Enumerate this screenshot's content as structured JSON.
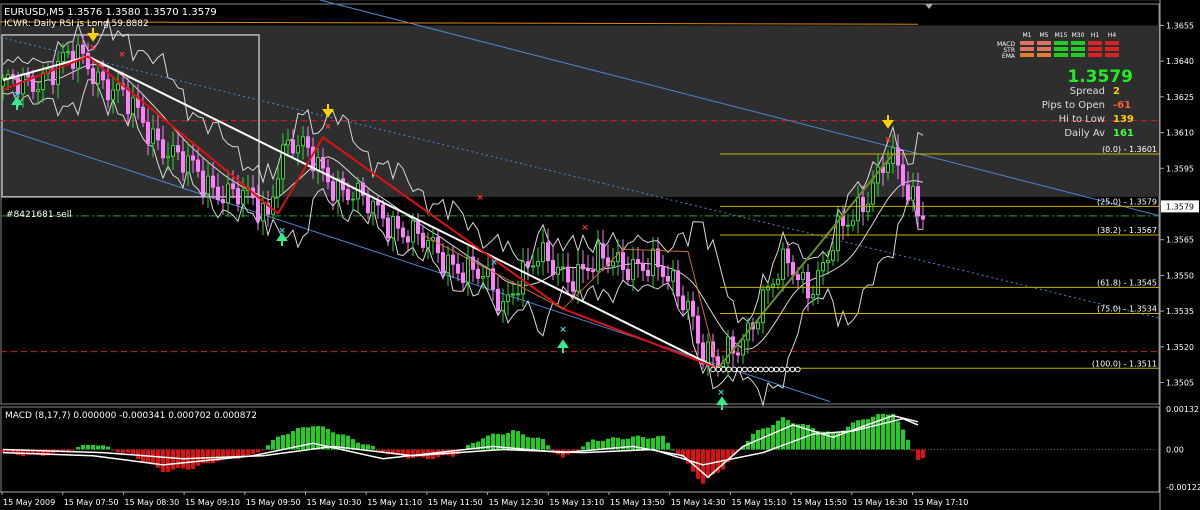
{
  "header": {
    "line1": "EURUSD,M5  1.3576 1.3580 1.3570 1.3579",
    "line2": "ICWR: Daily RSI is Long 59.8882"
  },
  "order_label": "#8421681 sell",
  "info_panel": {
    "timeframes": [
      "M1",
      "M5",
      "M15",
      "M30",
      "H1",
      "H4"
    ],
    "rows": [
      {
        "label": "MACD",
        "colors": [
          "#e07060",
          "#e07060",
          "#22cc22",
          "#22cc22",
          "#dd2222",
          "#dd2222"
        ]
      },
      {
        "label": "STR",
        "colors": [
          "#e07060",
          "#e07060",
          "#22cc22",
          "#22cc22",
          "#dd2222",
          "#dd2222"
        ]
      },
      {
        "label": "EMA",
        "colors": [
          "#e08030",
          "#e08030",
          "#22cc22",
          "#22cc22",
          "#dd2222",
          "#dd2222"
        ]
      }
    ],
    "price": "1.3579",
    "stats": [
      {
        "label": "Spread",
        "value": "2",
        "color": "#ffcc00"
      },
      {
        "label": "Pips to Open",
        "value": "-61",
        "color": "#ff5a2a"
      },
      {
        "label": "Hi to Low",
        "value": "139",
        "color": "#ffcc00"
      },
      {
        "label": "Daily Av",
        "value": "161",
        "color": "#44ff44"
      }
    ]
  },
  "colors": {
    "background": "#000000",
    "shaded": "#2e2e2e",
    "bull_candle": "#2ed82e",
    "bear_candle": "#ff80ff",
    "zigzag": "#dd1111",
    "trend": "#ffffff",
    "channel": "#4a86d4",
    "fib": "#c8b400",
    "macd_pos": "#22cc22",
    "macd_neg": "#dd1111",
    "axis_text": "#ffffff",
    "current_price_tag": "#ffffff"
  },
  "chart_data": [
    {
      "type": "candlestick",
      "title": "EURUSD,M5",
      "ylim": [
        1.3496,
        1.3664
      ],
      "y_ticks": [
        "1.3655",
        "1.3640",
        "1.3625",
        "1.3610",
        "1.3595",
        "1.3580",
        "1.3565",
        "1.3550",
        "1.3535",
        "1.3520",
        "1.3505"
      ],
      "current_price": "1.3579",
      "x_ticks": [
        "15 May 2009",
        "15 May 07:50",
        "15 May 08:30",
        "15 May 09:10",
        "15 May 09:50",
        "15 May 10:30",
        "15 May 11:10",
        "15 May 11:50",
        "15 May 12:30",
        "15 May 13:10",
        "15 May 13:50",
        "15 May 14:30",
        "15 May 15:10",
        "15 May 15:50",
        "15 May 16:30",
        "15 May 17:10"
      ],
      "close_path": [
        [
          0,
          1.3628
        ],
        [
          10,
          1.3636
        ],
        [
          15,
          1.3642
        ],
        [
          17,
          1.364
        ],
        [
          20,
          1.3632
        ],
        [
          28,
          1.3615
        ],
        [
          35,
          1.3598
        ],
        [
          42,
          1.3588
        ],
        [
          48,
          1.3582
        ],
        [
          53,
          1.3576
        ],
        [
          55,
          1.3598
        ],
        [
          57,
          1.3606
        ],
        [
          61,
          1.36
        ],
        [
          66,
          1.359
        ],
        [
          72,
          1.358
        ],
        [
          78,
          1.3573
        ],
        [
          84,
          1.3563
        ],
        [
          90,
          1.3556
        ],
        [
          96,
          1.3548
        ],
        [
          100,
          1.3538
        ],
        [
          103,
          1.355
        ],
        [
          107,
          1.3556
        ],
        [
          113,
          1.3551
        ],
        [
          120,
          1.3555
        ],
        [
          126,
          1.3556
        ],
        [
          130,
          1.3553
        ],
        [
          137,
          1.354
        ],
        [
          140,
          1.3518
        ],
        [
          143,
          1.3511
        ],
        [
          147,
          1.3521
        ],
        [
          152,
          1.354
        ],
        [
          157,
          1.3555
        ],
        [
          161,
          1.3546
        ],
        [
          164,
          1.3553
        ],
        [
          167,
          1.3566
        ],
        [
          171,
          1.3578
        ],
        [
          174,
          1.359
        ],
        [
          177,
          1.3599
        ],
        [
          179,
          1.3593
        ],
        [
          181,
          1.3583
        ],
        [
          183,
          1.3579
        ]
      ],
      "zigzag_red": [
        [
          0,
          1.3628
        ],
        [
          17,
          1.3642
        ],
        [
          55,
          1.3576
        ],
        [
          64,
          1.3608
        ],
        [
          112,
          1.3536
        ],
        [
          143,
          1.3511
        ]
      ],
      "zigzag_olive": [
        [
          143,
          1.3511
        ],
        [
          178,
          1.3601
        ]
      ],
      "trend_white": [
        [
          0,
          1.3632
        ],
        [
          17,
          1.3642
        ],
        [
          143,
          1.3511
        ]
      ],
      "fibonacci": {
        "levels": [
          {
            "label": "(0.0) - 1.3601",
            "value": 1.3601
          },
          {
            "label": "(25.0) - 1.3579",
            "value": 1.3579
          },
          {
            "label": "(38.2) - 1.3567",
            "value": 1.3567
          },
          {
            "label": "(61.8) - 1.3545",
            "value": 1.3545
          },
          {
            "label": "(75.0) - 1.3534",
            "value": 1.3534
          },
          {
            "label": "(100.0) - 1.3511",
            "value": 1.3511
          }
        ]
      },
      "horizontal_lines": [
        {
          "value": 1.3615,
          "style": "dash",
          "color": "#cc2222"
        },
        {
          "value": 1.3518,
          "style": "dash",
          "color": "#cc2222"
        },
        {
          "value": 1.3575,
          "style": "dashdot",
          "color": "#22aa22"
        }
      ]
    },
    {
      "type": "bar",
      "title": "MACD",
      "label": "MACD (8,17,7) 0.000000 -0.000341 0.000702 0.000872",
      "ylim": [
        -0.00138,
        0.00138
      ],
      "y_ticks": [
        "0.00132",
        "0.00",
        "-0.00122"
      ],
      "histogram": [
        [
          0,
          -0.0001
        ],
        [
          6,
          -0.0002
        ],
        [
          12,
          -0.0001
        ],
        [
          18,
          0.0002
        ],
        [
          26,
          -0.0002
        ],
        [
          32,
          -0.0007
        ],
        [
          38,
          -0.0006
        ],
        [
          44,
          -0.0003
        ],
        [
          50,
          -0.0002
        ],
        [
          56,
          0.0005
        ],
        [
          62,
          0.0008
        ],
        [
          66,
          0.0006
        ],
        [
          72,
          0.0002
        ],
        [
          78,
          -0.0002
        ],
        [
          84,
          -0.0003
        ],
        [
          90,
          -0.0002
        ],
        [
          96,
          0.0004
        ],
        [
          102,
          0.0006
        ],
        [
          108,
          0.0003
        ],
        [
          112,
          -0.0003
        ],
        [
          118,
          0.0003
        ],
        [
          126,
          0.0004
        ],
        [
          132,
          0.0004
        ],
        [
          136,
          -0.0003
        ],
        [
          140,
          -0.0011
        ],
        [
          144,
          -0.0006
        ],
        [
          150,
          0.0005
        ],
        [
          156,
          0.001
        ],
        [
          162,
          0.0007
        ],
        [
          166,
          0.0005
        ],
        [
          172,
          0.001
        ],
        [
          178,
          0.0012
        ],
        [
          183,
          -0.0003
        ]
      ],
      "main_line": [
        [
          0,
          -0.0001
        ],
        [
          18,
          -0.0002
        ],
        [
          32,
          -0.0005
        ],
        [
          50,
          -0.0002
        ],
        [
          62,
          0.0002
        ],
        [
          76,
          -0.0003
        ],
        [
          98,
          0.0001
        ],
        [
          112,
          -0.0001
        ],
        [
          126,
          0.0001
        ],
        [
          136,
          -0.0002
        ],
        [
          141,
          -0.0009
        ],
        [
          148,
          0.0001
        ],
        [
          158,
          0.0008
        ],
        [
          166,
          0.0004
        ],
        [
          178,
          0.0011
        ],
        [
          183,
          0.0009
        ]
      ],
      "signal_line": [
        [
          0,
          0.0
        ],
        [
          20,
          -0.0001
        ],
        [
          36,
          -0.0003
        ],
        [
          52,
          -0.0002
        ],
        [
          66,
          0.0001
        ],
        [
          82,
          -0.0002
        ],
        [
          100,
          0.0
        ],
        [
          116,
          -0.0001
        ],
        [
          130,
          0.0
        ],
        [
          140,
          -0.0005
        ],
        [
          152,
          -0.0001
        ],
        [
          162,
          0.0005
        ],
        [
          170,
          0.0006
        ],
        [
          180,
          0.001
        ],
        [
          183,
          0.0008
        ]
      ]
    }
  ]
}
